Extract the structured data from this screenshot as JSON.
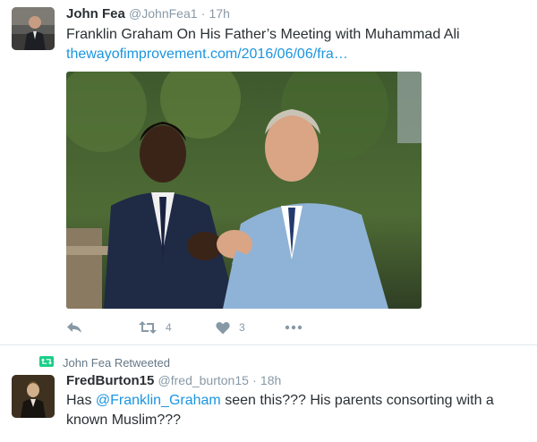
{
  "tweet1": {
    "name": "John Fea",
    "handle": "@JohnFea1",
    "separator": "·",
    "time": "17h",
    "text": "Franklin Graham On His Father’s Meeting with Muhammad Ali",
    "link": "thewayofimprovement.com/2016/06/06/fra…",
    "actions": {
      "reply_icon": "reply-icon",
      "retweet_icon": "retweet-icon",
      "retweet_count": "4",
      "like_icon": "heart-icon",
      "like_count": "3",
      "more_icon": "more-icon"
    }
  },
  "retweet_notice": {
    "icon": "retweet-icon",
    "label": "John Fea Retweeted"
  },
  "tweet2": {
    "name": "FredBurton15",
    "handle": "@fred_burton15",
    "separator": "·",
    "time": "18h",
    "text_before": "Has ",
    "mention": "@Franklin_Graham",
    "text_after": " seen this??? His parents consorting with a known Muslim???"
  },
  "colors": {
    "link": "#1b95e0",
    "meta": "#8899a6",
    "retweet_green": "#19cf86",
    "divider": "#e1e8ed"
  }
}
